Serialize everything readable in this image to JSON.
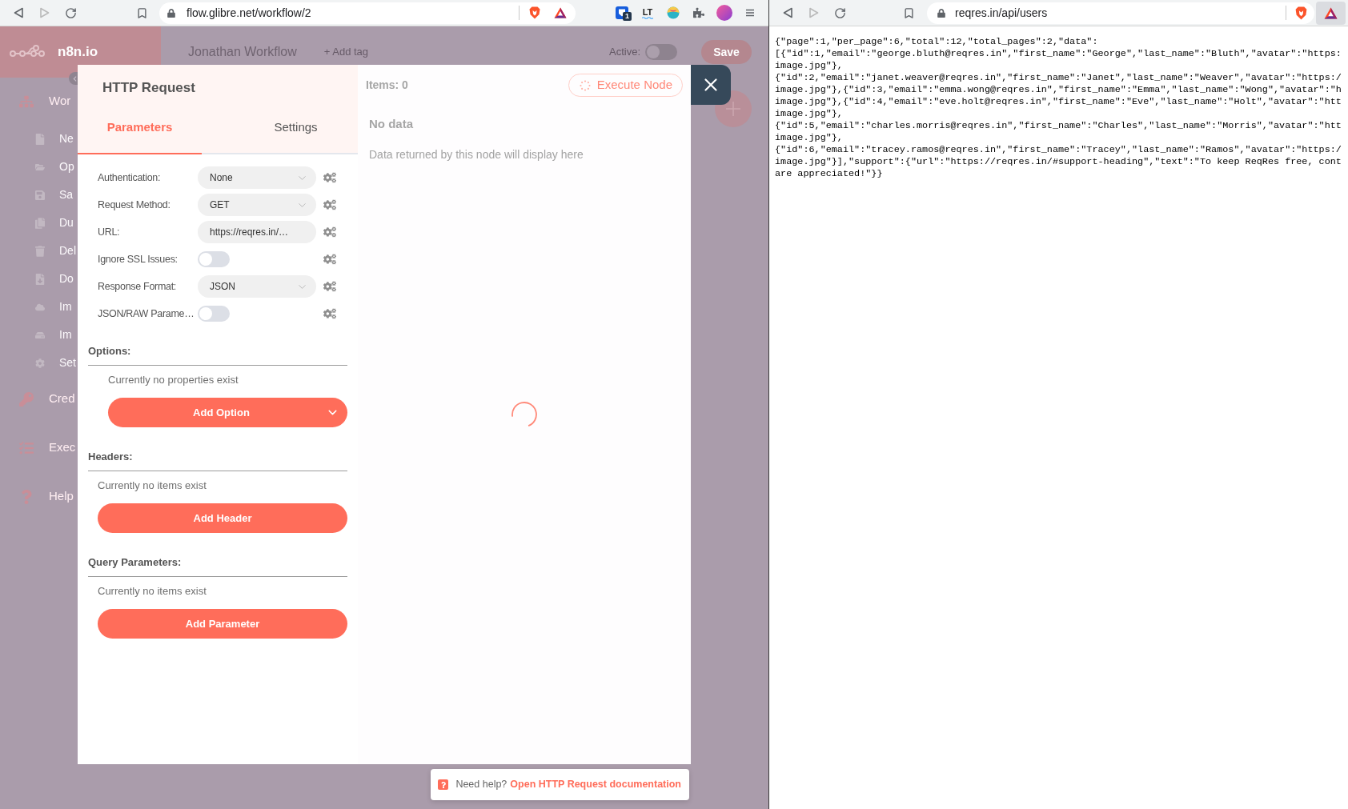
{
  "left_browser": {
    "forward_disabled": true,
    "url": "flow.glibre.net/workflow/2",
    "extension_badge": "1",
    "extension_label": "LT"
  },
  "app": {
    "logo": "n8n.io",
    "workflow_name": "Jonathan Workflow",
    "add_tag": "+ Add tag",
    "active_label": "Active:",
    "active": false,
    "save": "Save",
    "sidebar": [
      {
        "kind": "section",
        "label": "Wor"
      },
      {
        "kind": "item",
        "label": "Ne"
      },
      {
        "kind": "item",
        "label": "Op"
      },
      {
        "kind": "item",
        "label": "Sa"
      },
      {
        "kind": "item",
        "label": "Du"
      },
      {
        "kind": "item",
        "label": "Del"
      },
      {
        "kind": "item",
        "label": "Do"
      },
      {
        "kind": "item",
        "label": "Im"
      },
      {
        "kind": "item",
        "label": "Im"
      },
      {
        "kind": "item",
        "label": "Set"
      },
      {
        "kind": "section",
        "label": "Cred"
      },
      {
        "kind": "section",
        "label": "Exec"
      },
      {
        "kind": "section",
        "label": "Help"
      }
    ]
  },
  "dialog": {
    "title": "HTTP Request",
    "tabs": [
      {
        "label": "Parameters",
        "selected": true
      },
      {
        "label": "Settings",
        "selected": false
      }
    ],
    "parameters": [
      {
        "kind": "select",
        "label": "Authentication:",
        "value": "None"
      },
      {
        "kind": "select",
        "label": "Request Method:",
        "value": "GET"
      },
      {
        "kind": "input",
        "label": "URL:",
        "value": "https://reqres.in/…"
      },
      {
        "kind": "toggle",
        "label": "Ignore SSL Issues:",
        "on": false
      },
      {
        "kind": "select",
        "label": "Response Format:",
        "value": "JSON"
      },
      {
        "kind": "toggle",
        "label": "JSON/RAW Parame…",
        "on": false
      }
    ],
    "collections": [
      {
        "kind": "dropdown",
        "title": "Options:",
        "empty_text": "Currently no properties exist",
        "button": "Add Option"
      },
      {
        "kind": "plain",
        "title": "Headers:",
        "empty_text": "Currently no items exist",
        "button": "Add Header"
      },
      {
        "kind": "plain",
        "title": "Query Parameters:",
        "empty_text": "Currently no items exist",
        "button": "Add Parameter"
      }
    ],
    "output": {
      "items": "Items: 0",
      "execute": "Execute Node",
      "empty_title": "No data",
      "empty_text": "Data returned by this node will display here"
    },
    "help": {
      "text": "Need help?",
      "link": "Open HTTP Request documentation"
    }
  },
  "right_browser": {
    "forward_disabled": true,
    "url": "reqres.in/api/users",
    "body_lines": [
      "{\"page\":1,\"per_page\":6,\"total\":12,\"total_pages\":2,\"data\":",
      "[{\"id\":1,\"email\":\"george.bluth@reqres.in\",\"first_name\":\"George\",\"last_name\":\"Bluth\",\"avatar\":\"https:",
      "image.jpg\"},",
      "{\"id\":2,\"email\":\"janet.weaver@reqres.in\",\"first_name\":\"Janet\",\"last_name\":\"Weaver\",\"avatar\":\"https:/",
      "image.jpg\"},{\"id\":3,\"email\":\"emma.wong@reqres.in\",\"first_name\":\"Emma\",\"last_name\":\"Wong\",\"avatar\":\"h",
      "image.jpg\"},{\"id\":4,\"email\":\"eve.holt@reqres.in\",\"first_name\":\"Eve\",\"last_name\":\"Holt\",\"avatar\":\"htt",
      "image.jpg\"},",
      "{\"id\":5,\"email\":\"charles.morris@reqres.in\",\"first_name\":\"Charles\",\"last_name\":\"Morris\",\"avatar\":\"htt",
      "image.jpg\"},",
      "{\"id\":6,\"email\":\"tracey.ramos@reqres.in\",\"first_name\":\"Tracey\",\"last_name\":\"Ramos\",\"avatar\":\"https:/",
      "image.jpg\"}],\"support\":{\"url\":\"https://reqres.in/#support-heading\",\"text\":\"To keep ReqRes free, cont",
      "are appreciated!\"}}"
    ]
  }
}
